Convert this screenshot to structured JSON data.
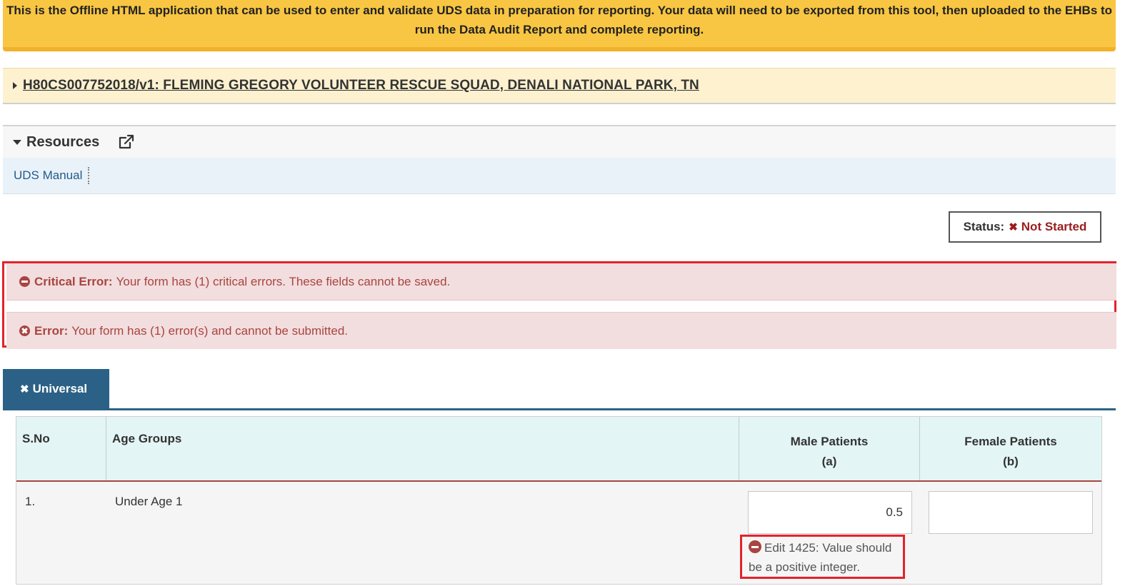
{
  "banner": {
    "text": "This is the Offline HTML application that can be used to enter and validate UDS data in preparation for reporting. Your data will need to be exported from this tool, then uploaded to the EHBs to run the Data Audit Report and complete reporting."
  },
  "grant": {
    "title": "H80CS007752018/v1: FLEMING GREGORY VOLUNTEER RESCUE SQUAD, DENALI NATIONAL PARK, TN"
  },
  "resources": {
    "title": "Resources",
    "links": [
      "UDS Manual"
    ]
  },
  "status": {
    "label": "Status:",
    "value": "Not Started"
  },
  "errors": {
    "critical_label": "Critical Error:",
    "critical_text": "Your form has (1) critical errors. These fields cannot be saved.",
    "error_label": "Error:",
    "error_text": "Your form has (1) error(s) and cannot be submitted."
  },
  "tab": {
    "label": "Universal"
  },
  "table": {
    "headers": {
      "sno": "S.No",
      "age_groups": "Age Groups",
      "male": "Male Patients",
      "male_sub": "(a)",
      "female": "Female Patients",
      "female_sub": "(b)"
    },
    "rows": [
      {
        "sno": "1.",
        "age_group": "Under Age 1",
        "male_value": "0.5",
        "female_value": "",
        "male_error": "Edit 1425: Value should be a positive integer."
      }
    ]
  },
  "colors": {
    "banner": "#f8c642",
    "tab": "#2b6186",
    "error_text": "#a94442",
    "error_bg": "#f2dede",
    "highlight": "#e3222a"
  }
}
